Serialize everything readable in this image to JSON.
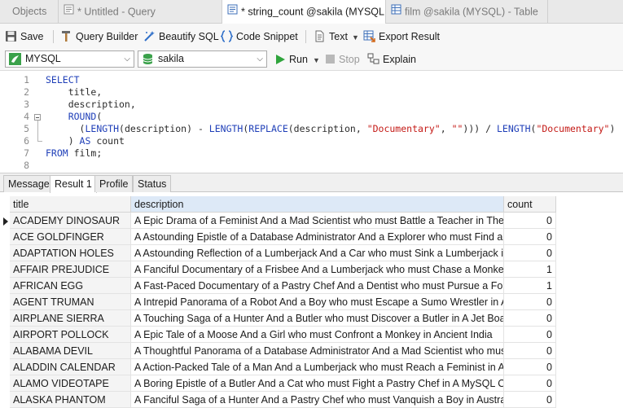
{
  "tabs": [
    {
      "label": "Objects",
      "icon": "none",
      "active": false
    },
    {
      "label": "* Untitled - Query",
      "icon": "query-icon",
      "active": false
    },
    {
      "label": "* string_count @sakila (MYSQL...",
      "icon": "query-icon",
      "active": true
    },
    {
      "label": "film @sakila (MYSQL) - Table",
      "icon": "table-icon",
      "active": false
    }
  ],
  "toolbar": {
    "save": "Save",
    "query_builder": "Query Builder",
    "beautify": "Beautify SQL",
    "code_snippet": "Code Snippet",
    "text": "Text",
    "export_result": "Export Result"
  },
  "connection": {
    "server": "MYSQL",
    "database": "sakila",
    "run": "Run",
    "stop": "Stop",
    "explain": "Explain"
  },
  "editor": {
    "line_numbers": [
      "1",
      "2",
      "3",
      "4",
      "5",
      "6",
      "7",
      "8"
    ]
  },
  "result_tabs": [
    {
      "label": "Message",
      "active": false
    },
    {
      "label": "Result 1",
      "active": true
    },
    {
      "label": "Profile",
      "active": false
    },
    {
      "label": "Status",
      "active": false
    }
  ],
  "grid": {
    "columns": [
      "title",
      "description",
      "count"
    ],
    "rows": [
      {
        "title": "ACADEMY DINOSAUR",
        "description": "A Epic Drama of a Feminist And a Mad Scientist who must Battle a Teacher in The Canadian Rockies",
        "count": "0"
      },
      {
        "title": "ACE GOLDFINGER",
        "description": "A Astounding Epistle of a Database Administrator And a Explorer who must Find a Car in Ancient China",
        "count": "0"
      },
      {
        "title": "ADAPTATION HOLES",
        "description": "A Astounding Reflection of a Lumberjack And a Car who must Sink a Lumberjack in A Baloon Factory",
        "count": "0"
      },
      {
        "title": "AFFAIR PREJUDICE",
        "description": "A Fanciful Documentary of a Frisbee And a Lumberjack who must Chase a Monkey in A Shark Tank",
        "count": "1"
      },
      {
        "title": "AFRICAN EGG",
        "description": "A Fast-Paced Documentary of a Pastry Chef And a Dentist who must Pursue a Forensic Psychologist in The Gulf of Mexico",
        "count": "1"
      },
      {
        "title": "AGENT TRUMAN",
        "description": "A Intrepid Panorama of a Robot And a Boy who must Escape a Sumo Wrestler in Ancient China",
        "count": "0"
      },
      {
        "title": "AIRPLANE SIERRA",
        "description": "A Touching Saga of a Hunter And a Butler who must Discover a Butler in A Jet Boat",
        "count": "0"
      },
      {
        "title": "AIRPORT POLLOCK",
        "description": "A Epic Tale of a Moose And a Girl who must Confront a Monkey in Ancient India",
        "count": "0"
      },
      {
        "title": "ALABAMA DEVIL",
        "description": "A Thoughtful Panorama of a Database Administrator And a Mad Scientist who must Outgun a Mad Scientist in A Jet Boat",
        "count": "0"
      },
      {
        "title": "ALADDIN CALENDAR",
        "description": "A Action-Packed Tale of a Man And a Lumberjack who must Reach a Feminist in Ancient China",
        "count": "0"
      },
      {
        "title": "ALAMO VIDEOTAPE",
        "description": "A Boring Epistle of a Butler And a Cat who must Fight a Pastry Chef in A MySQL Convention",
        "count": "0"
      },
      {
        "title": "ALASKA PHANTOM",
        "description": "A Fanciful Saga of a Hunter And a Pastry Chef who must Vanquish a Boy in Australia",
        "count": "0"
      }
    ]
  }
}
